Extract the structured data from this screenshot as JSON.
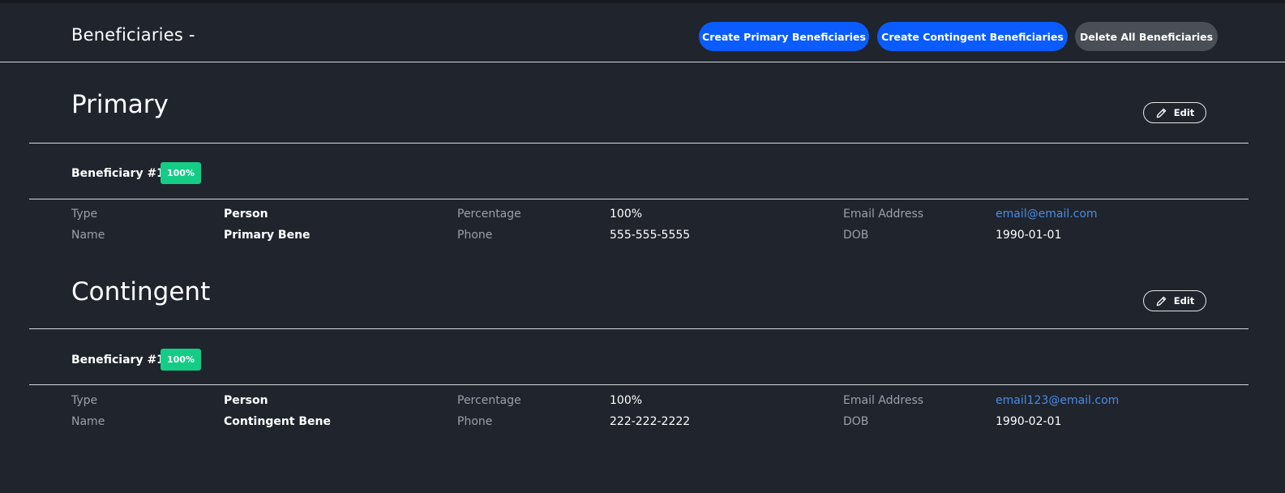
{
  "header": {
    "title": "Beneficiaries -",
    "create_primary_label": "Create Primary Beneficiaries",
    "create_contingent_label": "Create Contingent Beneficiaries",
    "delete_all_label": "Delete All Beneficiaries"
  },
  "colors": {
    "background": "#1f242d",
    "primary_button": "#0a5cff",
    "secondary_button": "#4a4e56",
    "badge": "#14cc86",
    "link": "#4a8de0"
  },
  "sections": [
    {
      "title": "Primary",
      "edit_label": "Edit",
      "beneficiary": {
        "label": "Beneficiary #1",
        "badge": "100%",
        "fields": {
          "type_label": "Type",
          "type_value": "Person",
          "name_label": "Name",
          "name_value": "Primary Bene",
          "percentage_label": "Percentage",
          "percentage_value": "100%",
          "phone_label": "Phone",
          "phone_value": "555-555-5555",
          "email_label": "Email Address",
          "email_value": "email@email.com",
          "dob_label": "DOB",
          "dob_value": "1990-01-01"
        }
      }
    },
    {
      "title": "Contingent",
      "edit_label": "Edit",
      "beneficiary": {
        "label": "Beneficiary #1",
        "badge": "100%",
        "fields": {
          "type_label": "Type",
          "type_value": "Person",
          "name_label": "Name",
          "name_value": "Contingent Bene",
          "percentage_label": "Percentage",
          "percentage_value": "100%",
          "phone_label": "Phone",
          "phone_value": "222-222-2222",
          "email_label": "Email Address",
          "email_value": "email123@email.com",
          "dob_label": "DOB",
          "dob_value": "1990-02-01"
        }
      }
    }
  ],
  "icons": {
    "edit": "pencil-icon"
  }
}
